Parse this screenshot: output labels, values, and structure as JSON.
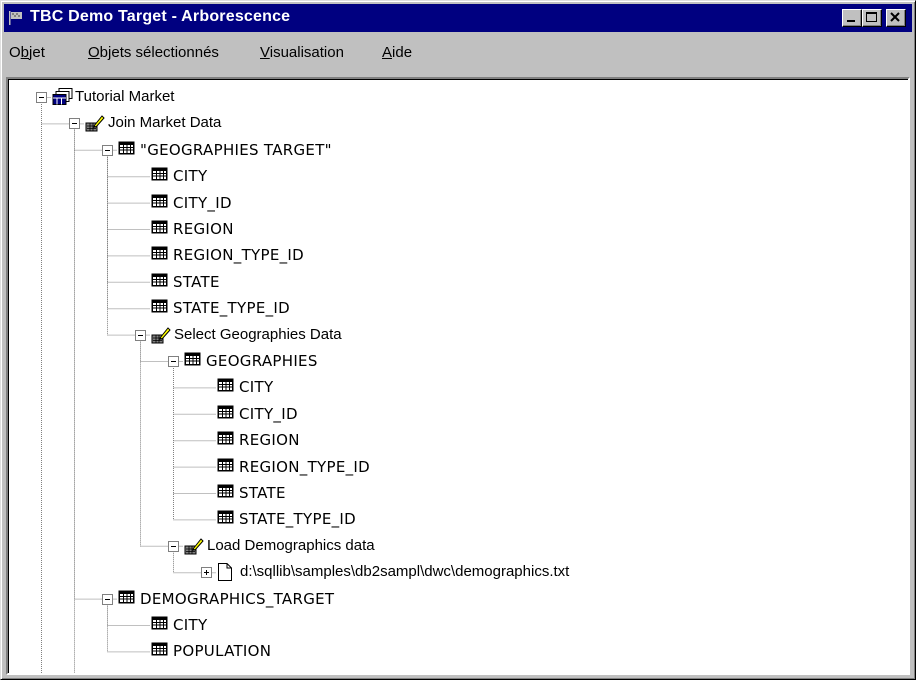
{
  "window": {
    "title": "TBC Demo Target - Arborescence",
    "colors": {
      "titlebar": "#000080",
      "face": "#c0c0c0",
      "tree_bg": "#ffffff"
    }
  },
  "menu": [
    {
      "label": "Objet",
      "mnemonic": "b"
    },
    {
      "label": "Objets sélectionnés",
      "mnemonic": "O"
    },
    {
      "label": "Visualisation",
      "mnemonic": "V"
    },
    {
      "label": "Aide",
      "mnemonic": "A"
    }
  ],
  "tree": [
    {
      "label": "Tutorial Market",
      "level": 0,
      "icon": "process-tables-icon",
      "toggle": "minus"
    },
    {
      "label": "Join Market Data",
      "level": 1,
      "icon": "step-icon",
      "toggle": "minus"
    },
    {
      "label": "\"GEOGRAPHIES TARGET\"",
      "level": 2,
      "icon": "table-icon",
      "toggle": "minus"
    },
    {
      "label": "CITY",
      "level": 3,
      "icon": "table-icon",
      "toggle": ""
    },
    {
      "label": "CITY_ID",
      "level": 3,
      "icon": "table-icon",
      "toggle": ""
    },
    {
      "label": "REGION",
      "level": 3,
      "icon": "table-icon",
      "toggle": ""
    },
    {
      "label": "REGION_TYPE_ID",
      "level": 3,
      "icon": "table-icon",
      "toggle": ""
    },
    {
      "label": "STATE",
      "level": 3,
      "icon": "table-icon",
      "toggle": ""
    },
    {
      "label": "STATE_TYPE_ID",
      "level": 3,
      "icon": "table-icon",
      "toggle": ""
    },
    {
      "label": "Select Geographies Data",
      "level": 3,
      "icon": "step-icon",
      "toggle": "minus"
    },
    {
      "label": "GEOGRAPHIES",
      "level": 4,
      "icon": "table-icon",
      "toggle": "minus"
    },
    {
      "label": "CITY",
      "level": 5,
      "icon": "table-icon",
      "toggle": ""
    },
    {
      "label": "CITY_ID",
      "level": 5,
      "icon": "table-icon",
      "toggle": ""
    },
    {
      "label": "REGION",
      "level": 5,
      "icon": "table-icon",
      "toggle": ""
    },
    {
      "label": "REGION_TYPE_ID",
      "level": 5,
      "icon": "table-icon",
      "toggle": ""
    },
    {
      "label": "STATE",
      "level": 5,
      "icon": "table-icon",
      "toggle": ""
    },
    {
      "label": "STATE_TYPE_ID",
      "level": 5,
      "icon": "table-icon",
      "toggle": ""
    },
    {
      "label": "Load Demographics data",
      "level": 4,
      "icon": "step-icon",
      "toggle": "minus"
    },
    {
      "label": "d:\\sqllib\\samples\\db2sampl\\dwc\\demographics.txt",
      "level": 5,
      "icon": "file-icon",
      "toggle": "plus"
    },
    {
      "label": "DEMOGRAPHICS_TARGET",
      "level": 2,
      "icon": "table-icon",
      "toggle": "minus"
    },
    {
      "label": "CITY",
      "level": 3,
      "icon": "table-icon",
      "toggle": ""
    },
    {
      "label": "POPULATION",
      "level": 3,
      "icon": "table-icon",
      "toggle": ""
    }
  ]
}
